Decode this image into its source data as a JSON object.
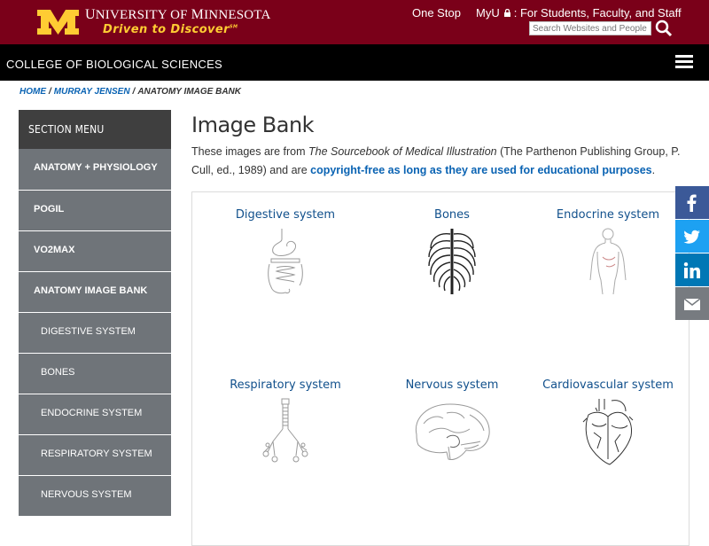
{
  "header": {
    "university_name_prefix": "U",
    "university_name_rest": "NIVERSITY OF ",
    "university_name_m": "M",
    "university_name_end": "INNESOTA",
    "tagline": "Driven to Discover",
    "tagline_mark": "SM",
    "one_stop": "One Stop",
    "myu_prefix": "MyU",
    "myu_suffix": ": For Students, Faculty, and Staff",
    "search_placeholder": "Search Websites and People"
  },
  "college": {
    "name": "COLLEGE OF BIOLOGICAL SCIENCES"
  },
  "breadcrumb": {
    "home": "HOME",
    "parent": "MURRAY JENSEN",
    "current": "ANATOMY IMAGE BANK",
    "separator": "/"
  },
  "sidebar": {
    "heading": "SECTION MENU",
    "items": [
      {
        "label": "ANATOMY + PHYSIOLOGY"
      },
      {
        "label": "POGIL"
      },
      {
        "label": "VO2MAX"
      },
      {
        "label": "ANATOMY IMAGE BANK"
      },
      {
        "label": "DIGESTIVE SYSTEM"
      },
      {
        "label": "BONES"
      },
      {
        "label": "ENDOCRINE SYSTEM"
      },
      {
        "label": "RESPIRATORY SYSTEM"
      },
      {
        "label": "NERVOUS SYSTEM"
      }
    ]
  },
  "main": {
    "title": "Image Bank",
    "intro_text_1": "These images are from ",
    "intro_book": "The Sourcebook of Medical Illustration",
    "intro_text_2": " (The Parthenon Publishing Group, P. Cull, ed., 1989) and are ",
    "intro_link": "copyright-free as long as they are used for educational purposes",
    "intro_text_3": ".",
    "gallery": [
      {
        "label": "Digestive system",
        "icon": "digestive-icon"
      },
      {
        "label": "Bones",
        "icon": "ribcage-icon"
      },
      {
        "label": "Endocrine system",
        "icon": "endocrine-icon"
      },
      {
        "label": "Respiratory system",
        "icon": "respiratory-icon"
      },
      {
        "label": "Nervous system",
        "icon": "brain-icon"
      },
      {
        "label": "Cardiovascular system",
        "icon": "heart-icon"
      }
    ]
  },
  "share": [
    {
      "name": "facebook",
      "color": "#3b5998"
    },
    {
      "name": "twitter",
      "color": "#1da1f2"
    },
    {
      "name": "linkedin",
      "color": "#0077b5"
    },
    {
      "name": "email",
      "color": "#777b80"
    }
  ],
  "colors": {
    "maroon": "#7a0019",
    "gold": "#ffcc33",
    "link": "#0a63b3",
    "menu": "#6f7479"
  }
}
